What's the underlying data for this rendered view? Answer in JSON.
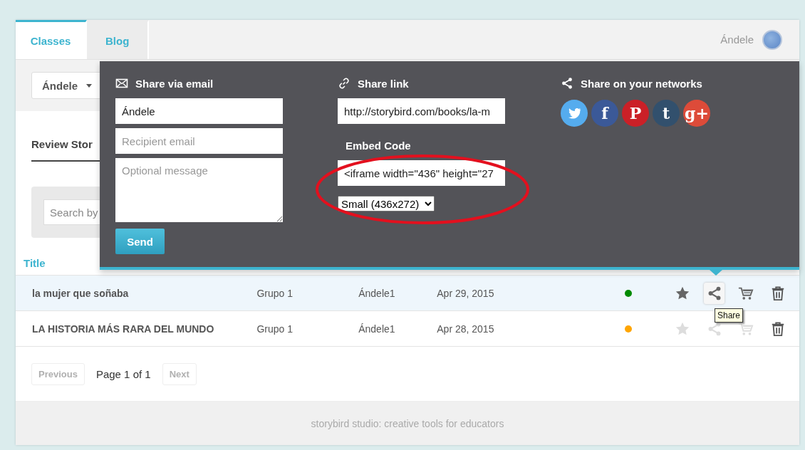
{
  "tabs": [
    {
      "label": "Classes",
      "selected": true
    },
    {
      "label": "Blog",
      "selected": false
    }
  ],
  "user": {
    "name": "Ándele"
  },
  "class_select": {
    "value": "Ándele"
  },
  "subtab": {
    "label": "Review Stor"
  },
  "search": {
    "placeholder": "Search by"
  },
  "table": {
    "columns": [
      {
        "label": "Title"
      }
    ],
    "rows": [
      {
        "title": "la mujer que soñaba",
        "group": "Grupo 1",
        "author": "Ándele1",
        "date": "Apr 29, 2015",
        "color": "#008a00",
        "selected": true,
        "actions_enabled": true,
        "share_active": true
      },
      {
        "title": "LA HISTORIA MÁS RARA DEL MUNDO",
        "group": "Grupo 1",
        "author": "Ándele1",
        "date": "Apr 28, 2015",
        "color": "#ffa500",
        "selected": false,
        "actions_enabled": false,
        "share_active": false
      }
    ]
  },
  "pagination": {
    "previous": {
      "label": "Previous",
      "disabled": true
    },
    "page": "Page 1 of 1",
    "next": {
      "label": "Next",
      "disabled": true
    }
  },
  "footer": "storybird studio: creative tools for educators",
  "share_popup": {
    "email": {
      "title": "Share via email",
      "name_value": "Ándele",
      "recipient_placeholder": "Recipient email",
      "message_placeholder": "Optional message",
      "send": "Send"
    },
    "link": {
      "title": "Share link",
      "url": "http://storybird.com/books/la-m",
      "embed_title": "Embed Code",
      "embed_value": "<iframe width=\"436\" height=\"27",
      "size": "Small (436x272)"
    },
    "networks": {
      "title": "Share on your networks",
      "items": [
        {
          "kind": "bird",
          "color": "#55acee"
        },
        {
          "kind": "glyph",
          "glyph": "f",
          "color": "#3b5998"
        },
        {
          "kind": "glyph",
          "glyph": "P",
          "color": "#cb2027"
        },
        {
          "kind": "glyph",
          "glyph": "t",
          "color": "#32506d"
        },
        {
          "kind": "glyph",
          "glyph": "g+",
          "color": "#dd4b39"
        }
      ]
    }
  },
  "tooltip": "Share"
}
